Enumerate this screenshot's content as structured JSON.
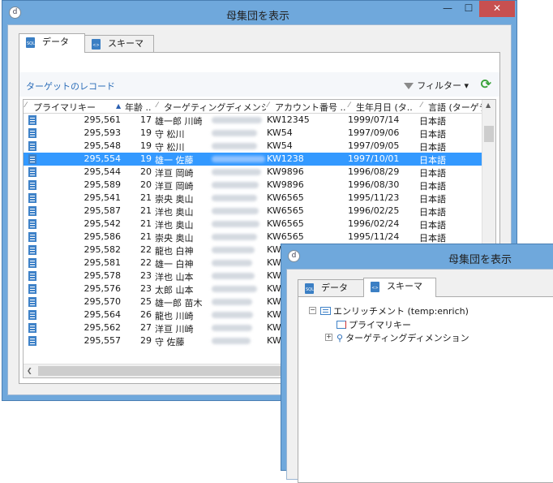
{
  "window1": {
    "title": "母集団を表示",
    "tabs": [
      {
        "label": "データ",
        "icon": "sql-icon",
        "active": true
      },
      {
        "label": "スキーマ",
        "icon": "schema-icon",
        "active": false
      }
    ],
    "toolbar": {
      "target_records": "ターゲットのレコード",
      "filter_label": "フィルター"
    },
    "columns": [
      "プライマリキー",
      "年齢 ..",
      "ターゲティングディメンション",
      "アカウント番号 ..",
      "生年月日 (タ..",
      "言語 (ターゲティ"
    ],
    "rows": [
      {
        "key": "295,561",
        "age": "17",
        "name": "雄一郎 川崎",
        "account": "KW12345",
        "birth": "1999/07/14",
        "lang": "日本語"
      },
      {
        "key": "295,593",
        "age": "19",
        "name": "守 松川",
        "account": "KW54",
        "birth": "1997/09/06",
        "lang": "日本語"
      },
      {
        "key": "295,548",
        "age": "19",
        "name": "守 松川",
        "account": "KW54",
        "birth": "1997/09/05",
        "lang": "日本語"
      },
      {
        "key": "295,554",
        "age": "19",
        "name": "雄一 佐藤",
        "account": "KW1238",
        "birth": "1997/10/01",
        "lang": "日本語",
        "selected": true
      },
      {
        "key": "295,544",
        "age": "20",
        "name": "洋亘 岡崎",
        "account": "KW9896",
        "birth": "1996/08/29",
        "lang": "日本語"
      },
      {
        "key": "295,589",
        "age": "20",
        "name": "洋亘 岡崎",
        "account": "KW9896",
        "birth": "1996/08/30",
        "lang": "日本語"
      },
      {
        "key": "295,541",
        "age": "21",
        "name": "崇央 奥山",
        "account": "KW6565",
        "birth": "1995/11/23",
        "lang": "日本語"
      },
      {
        "key": "295,587",
        "age": "21",
        "name": "洋也 奥山",
        "account": "KW6565",
        "birth": "1996/02/25",
        "lang": "日本語"
      },
      {
        "key": "295,542",
        "age": "21",
        "name": "洋也 奥山",
        "account": "KW6565",
        "birth": "1996/02/24",
        "lang": "日本語"
      },
      {
        "key": "295,586",
        "age": "21",
        "name": "崇央 奥山",
        "account": "KW6565",
        "birth": "1995/11/24",
        "lang": "日本語"
      },
      {
        "key": "295,582",
        "age": "22",
        "name": "龍也 白神",
        "account": "KW",
        "birth": "",
        "lang": ""
      },
      {
        "key": "295,581",
        "age": "22",
        "name": "雄一 白神",
        "account": "KW",
        "birth": "",
        "lang": ""
      },
      {
        "key": "295,578",
        "age": "23",
        "name": "洋也 山本",
        "account": "KW",
        "birth": "",
        "lang": ""
      },
      {
        "key": "295,576",
        "age": "23",
        "name": "太郎 山本",
        "account": "KW",
        "birth": "",
        "lang": ""
      },
      {
        "key": "295,570",
        "age": "25",
        "name": "雄一郎 苗木",
        "account": "KW",
        "birth": "",
        "lang": ""
      },
      {
        "key": "295,564",
        "age": "26",
        "name": "龍也 川崎",
        "account": "KW",
        "birth": "",
        "lang": ""
      },
      {
        "key": "295,562",
        "age": "27",
        "name": "洋亘 川崎",
        "account": "KW",
        "birth": "",
        "lang": ""
      },
      {
        "key": "295,557",
        "age": "29",
        "name": "守 佐藤",
        "account": "KW",
        "birth": "",
        "lang": ""
      }
    ]
  },
  "window2": {
    "title": "母集団を表示",
    "tabs": [
      {
        "label": "データ",
        "icon": "sql-icon",
        "active": false
      },
      {
        "label": "スキーマ",
        "icon": "schema-icon",
        "active": true
      }
    ],
    "tree": {
      "root": "エンリッチメント (temp:enrich)",
      "children": [
        "プライマリキー",
        "ターゲティングディメンション"
      ]
    }
  }
}
